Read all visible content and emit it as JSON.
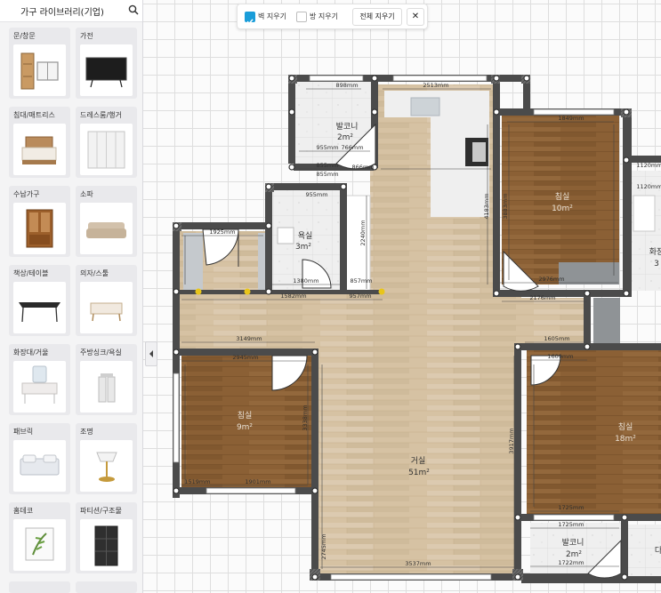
{
  "sidebar": {
    "title": "가구 라이브러리(기업)",
    "search_icon": "search-icon",
    "categories": [
      {
        "label": "문/창문",
        "thumb": "door-window"
      },
      {
        "label": "가전",
        "thumb": "tv"
      },
      {
        "label": "침대/매트리스",
        "thumb": "bed"
      },
      {
        "label": "드레스룸/행거",
        "thumb": "wardrobe"
      },
      {
        "label": "수납가구",
        "thumb": "cabinet"
      },
      {
        "label": "소파",
        "thumb": "sofa"
      },
      {
        "label": "책상/테이블",
        "thumb": "table"
      },
      {
        "label": "의자/스툴",
        "thumb": "bench"
      },
      {
        "label": "화장대/거울",
        "thumb": "vanity"
      },
      {
        "label": "주방싱크/욕실",
        "thumb": "sink"
      },
      {
        "label": "패브릭",
        "thumb": "bedding"
      },
      {
        "label": "조명",
        "thumb": "lamp"
      },
      {
        "label": "홈데코",
        "thumb": "plant-frame"
      },
      {
        "label": "파티션/구조물",
        "thumb": "locker"
      }
    ],
    "collapse_icon": "chevron-left-icon"
  },
  "toolbar": {
    "wall_erase": {
      "label": "벽 지우기",
      "checked": true
    },
    "room_erase": {
      "label": "방 지우기",
      "checked": false
    },
    "clear_all": "전체 지우기",
    "close": "✕"
  },
  "floorplan": {
    "rooms": {
      "balcony_top": {
        "name": "발코니",
        "area": "2m²"
      },
      "bath_left": {
        "name": "욕실",
        "area": "3m²"
      },
      "bedroom_nw": {
        "name": "침실",
        "area": "10m²"
      },
      "bath_right": {
        "name": "화장",
        "area": "3"
      },
      "bedroom_w": {
        "name": "침실",
        "area": "9m²"
      },
      "living": {
        "name": "거실",
        "area": "51m²"
      },
      "bedroom_se": {
        "name": "침실",
        "area": "18m²"
      },
      "balcony_bottom": {
        "name": "발코니",
        "area": "2m²"
      },
      "partial_right": {
        "name": "다",
        "area": ""
      }
    },
    "dims": {
      "d898": "898mm",
      "d2513": "2513mm",
      "d955": "955mm",
      "d766": "766mm",
      "d855": "855mm",
      "d866": "866mm",
      "d1849": "1849mm",
      "d1120": "1120mm",
      "d1925": "1925mm",
      "d1380": "1380mm",
      "d857": "857mm",
      "d1582": "1582mm",
      "d957": "957mm",
      "d2976": "2976mm",
      "d2176": "2176mm",
      "d3149": "3149mm",
      "d2945": "2945mm",
      "d1605": "1605mm",
      "d1609": "1609mm",
      "d1519": "1519mm",
      "d1901": "1901mm",
      "d3537": "3537mm",
      "d1725": "1725mm",
      "d1722": "1722mm",
      "v4183": "4183mm",
      "v3883": "3883mm",
      "v2240": "2240mm",
      "v3338": "3338mm",
      "v3917": "3917mm",
      "v2745": "2745mm"
    }
  },
  "colors": {
    "accent": "#1a9dd9",
    "wall": "#4b4b4b",
    "wood_light": "#d7c4a7",
    "wood_dark": "#8a5f33",
    "tile": "#ececec"
  }
}
